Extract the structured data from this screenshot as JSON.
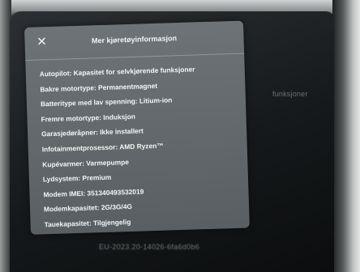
{
  "modal": {
    "title": "Mer kjøretøyinformasjon",
    "close_label": "✕"
  },
  "specs": [
    {
      "label": "Autopilot:",
      "value": "Kapasitet for selvkjørende funksjoner"
    },
    {
      "label": "Bakre motortype:",
      "value": "Permanentmagnet"
    },
    {
      "label": "Batteritype med lav spenning:",
      "value": "Litium-ion"
    },
    {
      "label": "Fremre motortype:",
      "value": "Induksjon"
    },
    {
      "label": "Garasjedøråpner:",
      "value": "Ikke installert"
    },
    {
      "label": "Infotainmentprosessor:",
      "value": "AMD Ryzen™"
    },
    {
      "label": "Kupévarmer:",
      "value": "Varmepumpe"
    },
    {
      "label": "Lydsystem:",
      "value": "Premium"
    },
    {
      "label": "Modem IMEI:",
      "value": "351340493532019"
    },
    {
      "label": "Modemkapasitet:",
      "value": "2G/3G/4G"
    },
    {
      "label": "Tauekapasitet:",
      "value": "Tilgjengelig"
    }
  ],
  "background": {
    "side_label": "funksjoner",
    "footer": "EU-2023.20-14026-6fa6d0b6"
  }
}
